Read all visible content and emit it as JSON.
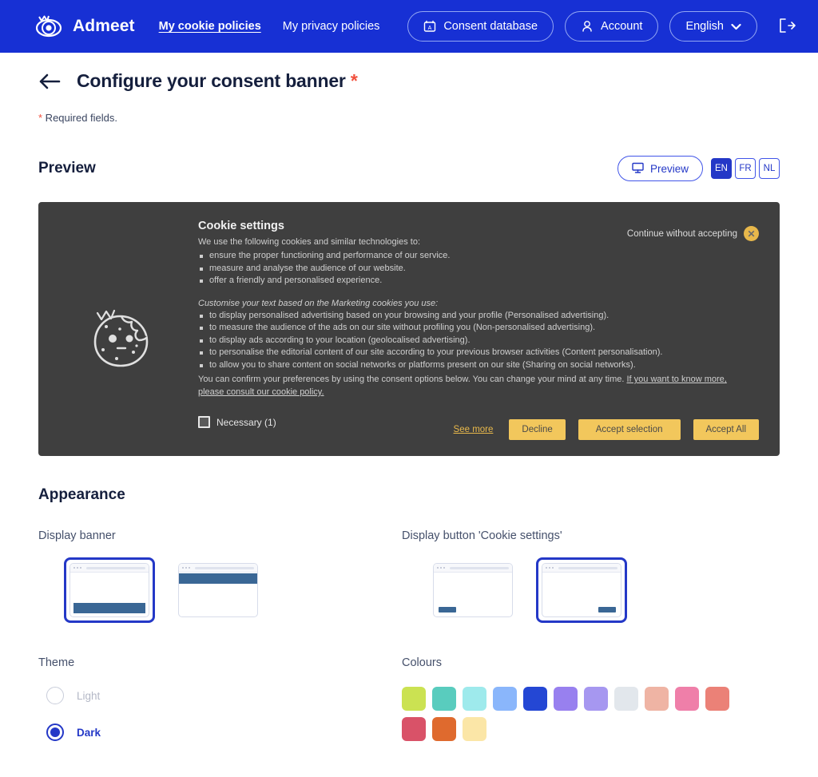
{
  "header": {
    "brand": "Admeet",
    "nav": [
      {
        "label": "My cookie policies",
        "active": true
      },
      {
        "label": "My privacy policies",
        "active": false
      }
    ],
    "consent_db_label": "Consent database",
    "account_label": "Account",
    "language_label": "English"
  },
  "page": {
    "title": "Configure your consent banner",
    "title_star": "*",
    "required_star": "*",
    "required_note": " Required fields."
  },
  "preview_section": {
    "title": "Preview",
    "preview_button": "Preview",
    "languages": [
      {
        "code": "EN",
        "selected": true
      },
      {
        "code": "FR",
        "selected": false
      },
      {
        "code": "NL",
        "selected": false
      }
    ]
  },
  "banner": {
    "heading": "Cookie settings",
    "continue_without_accepting": "Continue without accepting",
    "close_glyph": "✕",
    "intro": "We use the following cookies and similar technologies to:",
    "intro_bullets": [
      "ensure the proper functioning and performance of our service.",
      "measure and analyse the audience of our website.",
      "offer a friendly and personalised experience."
    ],
    "customise_note": "Customise your text based on the Marketing cookies you use:",
    "marketing_bullets": [
      "to display personalised advertising based on your browsing and your profile (Personalised advertising).",
      "to measure the audience of the ads on our site without profiling you (Non-personalised advertising).",
      "to display ads according to your location (geolocalised advertising).",
      "to personalise the editorial content of our site according to your previous browser activities (Content personalisation).",
      "to allow you to share content on social networks or platforms present on our site (Sharing on social networks)."
    ],
    "confirm_text": "You can confirm your preferences by using the consent options below. You can change your mind at any time. ",
    "confirm_link": "If you want to know more, please consult our cookie policy.",
    "necessary_label": "Necessary (1)",
    "see_more": "See more",
    "decline": "Decline",
    "accept_selection": "Accept selection",
    "accept_all": "Accept All"
  },
  "appearance": {
    "title": "Appearance",
    "display_banner_label": "Display banner",
    "display_button_label": "Display button 'Cookie settings'",
    "theme_label": "Theme",
    "colours_label": "Colours",
    "theme_options": [
      {
        "label": "Light",
        "selected": false
      },
      {
        "label": "Dark",
        "selected": true
      }
    ],
    "banner_positions": [
      {
        "name": "bottom",
        "selected": true
      },
      {
        "name": "top",
        "selected": false
      }
    ],
    "button_positions": [
      {
        "name": "bottom-left",
        "selected": false
      },
      {
        "name": "bottom-right",
        "selected": true
      }
    ],
    "colours": [
      "#cbe252",
      "#59ccbe",
      "#9eeaec",
      "#8ab6fb",
      "#2447d4",
      "#9880ef",
      "#a697f0",
      "#e2e7ec",
      "#efb4a4",
      "#ef7fa9",
      "#eb8177",
      "#d95268",
      "#df6a2e",
      "#fbe6a7"
    ]
  },
  "theme_colors": {
    "brand_blue": "#1730d4",
    "accent_blue": "#2438c7",
    "banner_bg": "#3f3f3f",
    "cookie_button": "#f2c75c",
    "required_red": "#f1503d"
  }
}
